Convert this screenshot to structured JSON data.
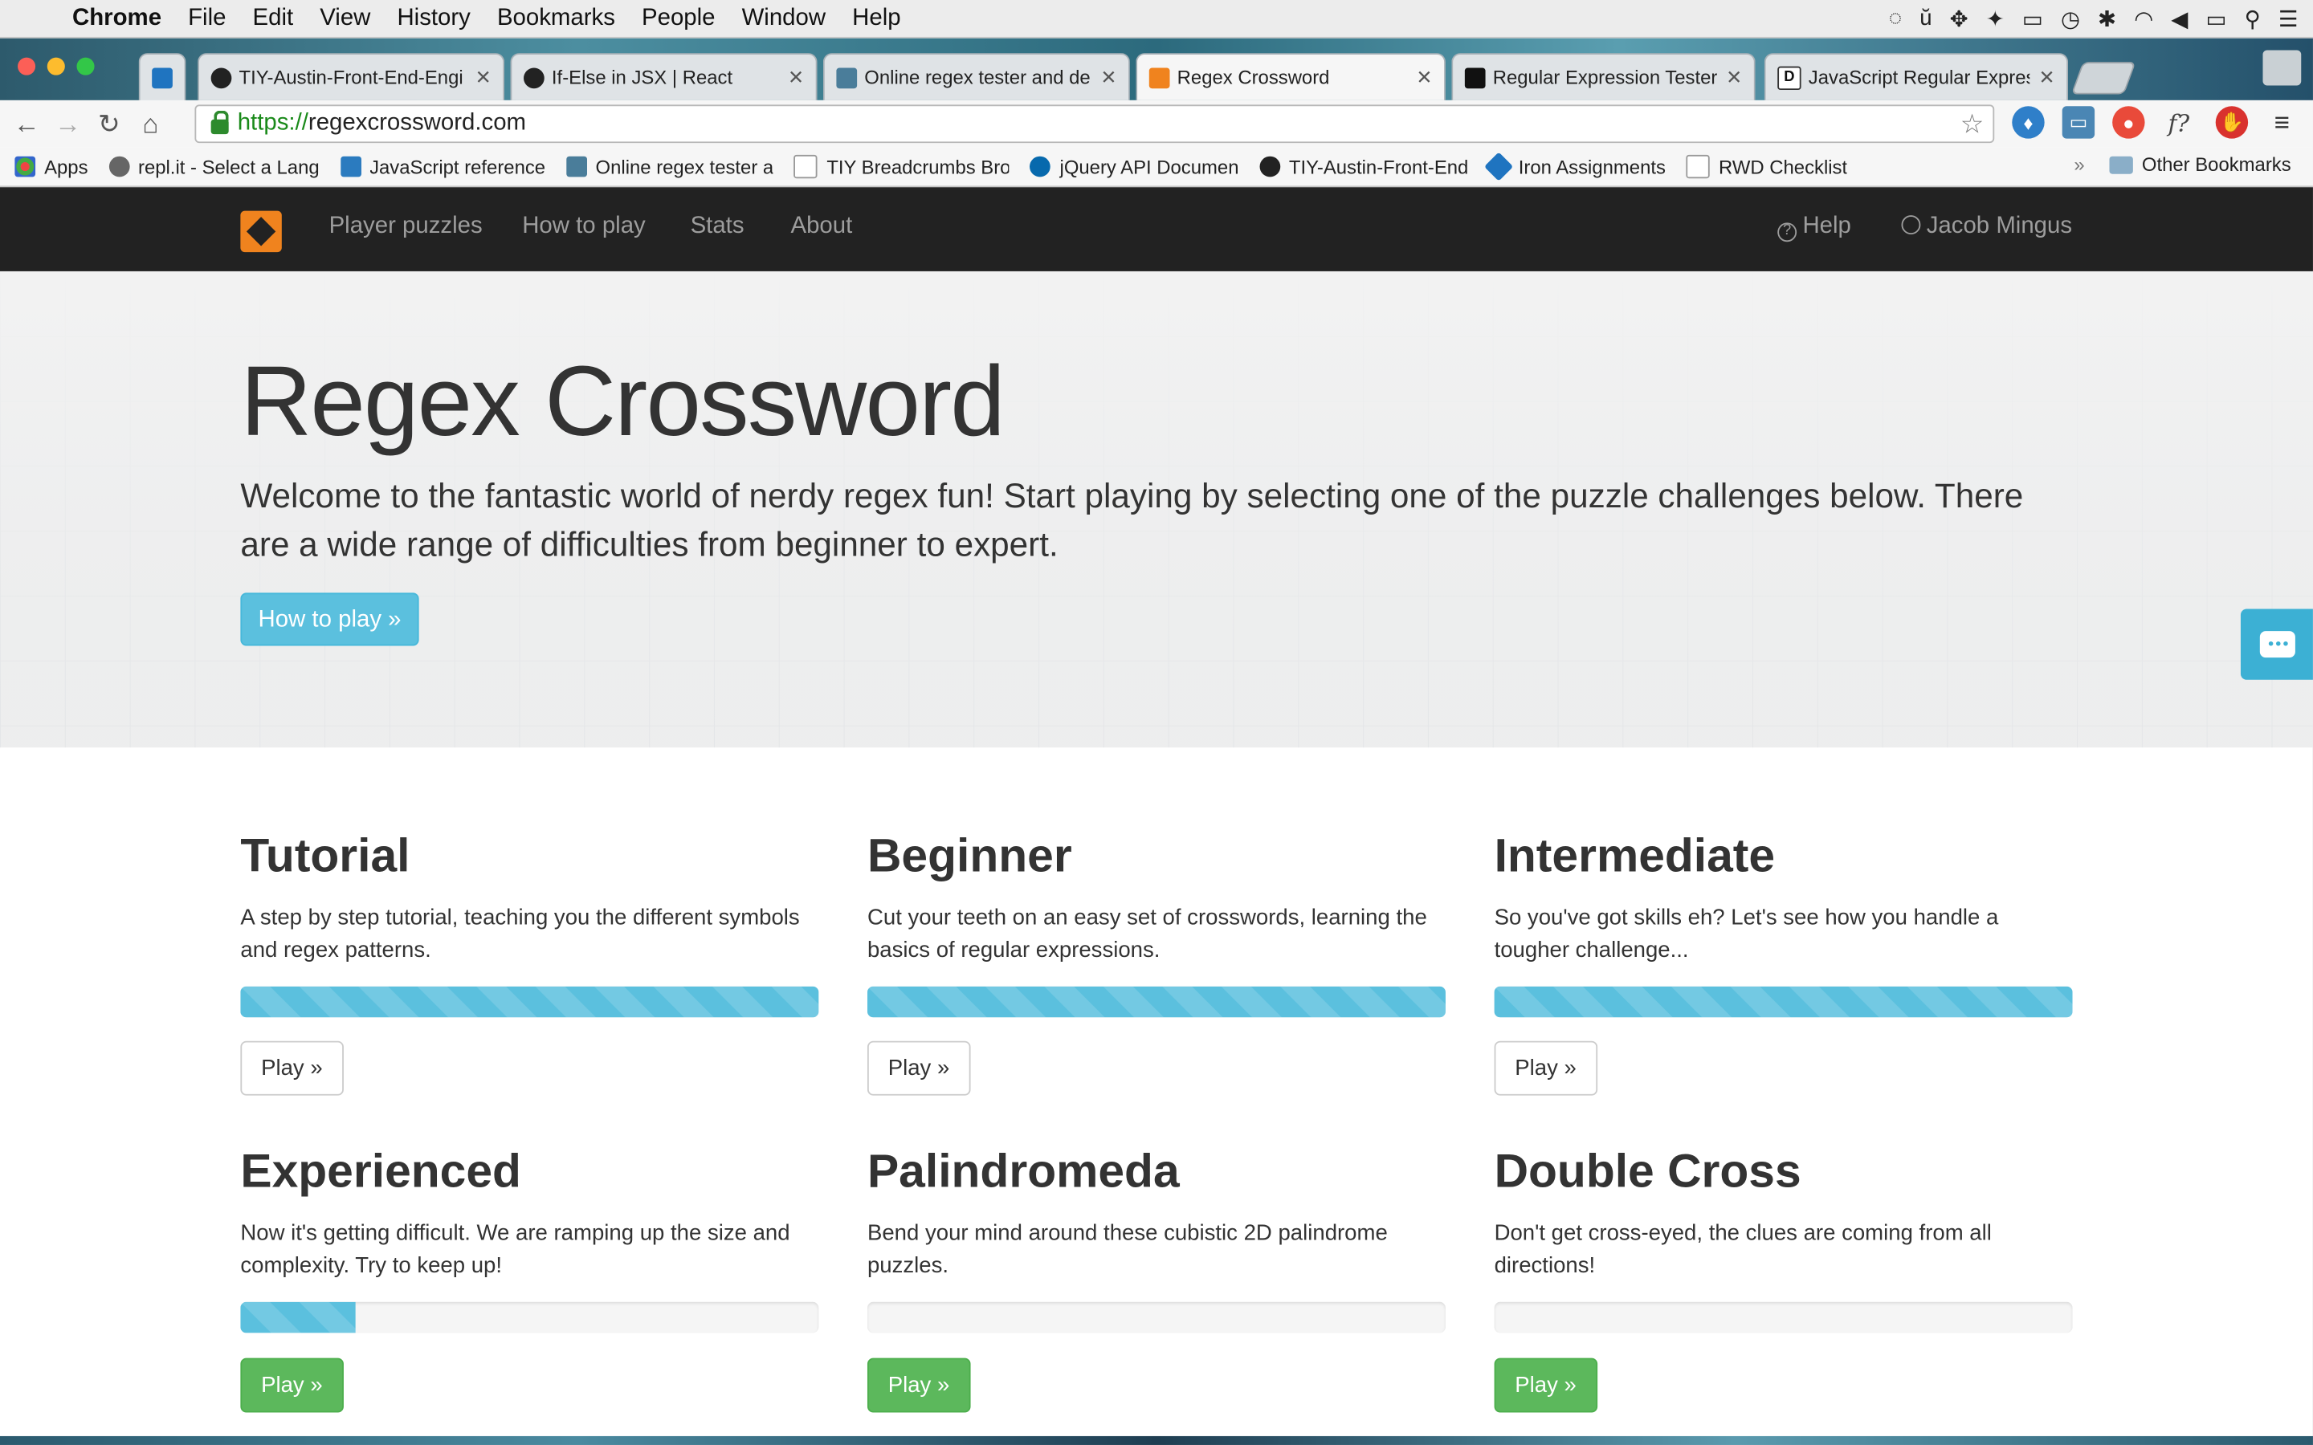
{
  "menubar": {
    "app": "Chrome",
    "items": [
      "File",
      "Edit",
      "View",
      "History",
      "Bookmarks",
      "People",
      "Window",
      "Help"
    ]
  },
  "tabs": [
    {
      "label": "TIY-Austin-Front-End-Engi",
      "icon": "github-icon",
      "color": "#222222"
    },
    {
      "label": "If-Else in JSX | React",
      "icon": "react-icon",
      "color": "#222222"
    },
    {
      "label": "Online regex tester and de",
      "icon": "regex101-icon",
      "color": "#4a7d9a"
    },
    {
      "label": "Regex Crossword",
      "icon": "regex-crossword-icon",
      "color": "#f0831e"
    },
    {
      "label": "Regular Expression Tester",
      "icon": "flag-icon",
      "color": "#111111"
    },
    {
      "label": "JavaScript Regular Express",
      "icon": "d-icon",
      "color": "#ffffff"
    }
  ],
  "address": {
    "scheme": "https://",
    "host": "regexcrossword.com"
  },
  "bookmarks": {
    "apps_label": "Apps",
    "items": [
      {
        "label": "repl.it - Select a Lang",
        "color": "#666666"
      },
      {
        "label": "JavaScript reference",
        "color": "#2b7bbf"
      },
      {
        "label": "Online regex tester a",
        "color": "#4a7d9a"
      },
      {
        "label": "TIY Breadcrumbs Bro",
        "color": "#dddddd"
      },
      {
        "label": "jQuery API Documen",
        "color": "#0769ad"
      },
      {
        "label": "TIY-Austin-Front-End",
        "color": "#222222"
      },
      {
        "label": "Iron Assignments",
        "color": "#1f74c0"
      },
      {
        "label": "RWD Checklist",
        "color": "#dddddd"
      }
    ],
    "more": "»",
    "other": "Other Bookmarks"
  },
  "sitenav": {
    "links": [
      "Player puzzles",
      "How to play",
      "Stats",
      "About"
    ],
    "help": "Help",
    "user": "Jacob Mingus"
  },
  "hero": {
    "title": "Regex Crossword",
    "text": "Welcome to the fantastic world of nerdy regex fun! Start playing by selecting one of the puzzle challenges below. There are a wide range of difficulties from beginner to expert.",
    "button": "How to play »"
  },
  "puzzles": [
    {
      "title": "Tutorial",
      "desc": "A step by step tutorial, teaching you the different symbols and regex patterns.",
      "progress": 1.0,
      "button": "Play »",
      "style": "default"
    },
    {
      "title": "Beginner",
      "desc": "Cut your teeth on an easy set of crosswords, learning the basics of regular expressions.",
      "progress": 1.0,
      "button": "Play »",
      "style": "default"
    },
    {
      "title": "Intermediate",
      "desc": "So you've got skills eh? Let's see how you handle a tougher challenge...",
      "progress": 1.0,
      "button": "Play »",
      "style": "default"
    },
    {
      "title": "Experienced",
      "desc": "Now it's getting difficult. We are ramping up the size and complexity. Try to keep up!",
      "progress": 0.2,
      "button": "Play »",
      "style": "success"
    },
    {
      "title": "Palindromeda",
      "desc": "Bend your mind around these cubistic 2D palindrome puzzles.",
      "progress": 0.0,
      "button": "Play »",
      "style": "success"
    },
    {
      "title": "Double Cross",
      "desc": "Don't get cross-eyed, the clues are coming from all directions!",
      "progress": 0.0,
      "button": "Play »",
      "style": "success"
    }
  ],
  "colors": {
    "nav_bg": "#222222",
    "info": "#5bc0de",
    "success": "#5cb85c",
    "logo": "#f0831e"
  }
}
